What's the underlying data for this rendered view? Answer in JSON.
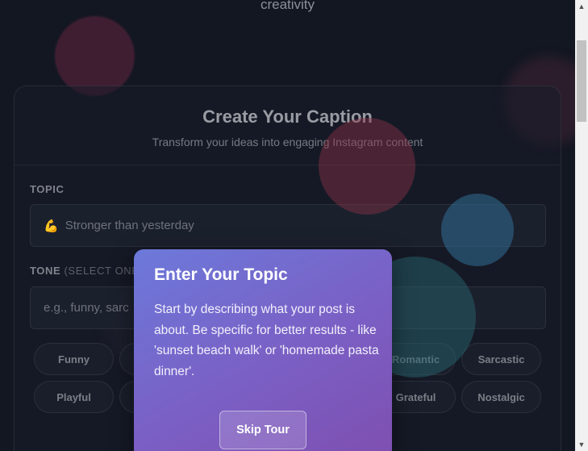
{
  "hero": {
    "tagline": "creativity"
  },
  "card": {
    "title": "Create Your Caption",
    "subtitle": "Transform your ideas into engaging Instagram content"
  },
  "topic": {
    "label": "TOPIC",
    "emoji": "💪",
    "placeholder": "Stronger than yesterday"
  },
  "tone": {
    "label": "TONE",
    "label_hint": "(SELECT ONE",
    "placeholder": "e.g., funny, sarc",
    "chips_row1": [
      "Funny",
      "Romantic",
      "Sarcastic"
    ],
    "chips_row2": [
      "Playful",
      "Grateful",
      "Nostalgic"
    ]
  },
  "tour": {
    "title": "Enter Your Topic",
    "body": "Start by describing what your post is about. Be specific for better results - like 'sunset beach walk' or 'homemade pasta dinner'.",
    "skip_label": "Skip Tour"
  },
  "colors": {
    "background": "#131722",
    "tour_gradient_start": "#6c79da",
    "tour_gradient_end": "#7e4fb0"
  }
}
